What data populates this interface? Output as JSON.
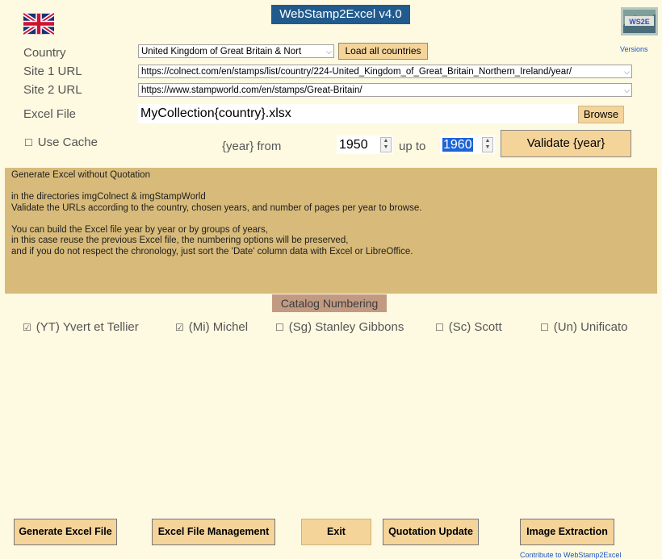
{
  "app": {
    "title": "WebStamp2Excel v4.0",
    "versions_link": "Versions"
  },
  "country": {
    "label": "Country",
    "value": "United Kingdom of Great Britain & Nort",
    "load_button": "Load all countries"
  },
  "site1": {
    "label": "Site 1 URL",
    "value": "https://colnect.com/en/stamps/list/country/224-United_Kingdom_of_Great_Britain_Northern_Ireland/year/"
  },
  "site2": {
    "label": "Site 2 URL",
    "value": "https://www.stampworld.com/en/stamps/Great-Britain/"
  },
  "excel": {
    "label": "Excel File",
    "value": "MyCollection{country}.xlsx",
    "browse_button": "Browse"
  },
  "cache": {
    "label": "Use Cache",
    "checked": false
  },
  "years": {
    "from_label": "{year} from",
    "from_value": "1950",
    "upto_label": "up to",
    "upto_value": "1960",
    "validate_button": "Validate {year}"
  },
  "info": {
    "line1": "Generate Excel without Quotation",
    "line2": "in the directories imgColnect & imgStampWorld",
    "line3": "Validate the URLs according to the country, chosen years, and number of pages per year to browse.",
    "line4": "You can build the Excel file year by year or by groups of years,",
    "line5": "in this case reuse the previous Excel file, the numbering options will be preserved,",
    "line6": "and if you do not respect the chronology, just sort the 'Date' column data with Excel or LibreOffice."
  },
  "catalog": {
    "title": "Catalog Numbering",
    "options": [
      {
        "label": "(YT) Yvert et Tellier",
        "checked": true
      },
      {
        "label": "(Mi) Michel",
        "checked": true
      },
      {
        "label": "(Sg) Stanley Gibbons",
        "checked": false
      },
      {
        "label": "(Sc) Scott",
        "checked": false
      },
      {
        "label": "(Un) Unificato",
        "checked": false
      }
    ]
  },
  "buttons": {
    "generate": "Generate Excel File",
    "management": "Excel File Management",
    "exit": "Exit",
    "quotation": "Quotation Update",
    "image": "Image Extraction"
  },
  "contribute_link": "Contribute to WebStamp2Excel",
  "colors": {
    "background": "#fef9e1",
    "title_bg": "#215a8c",
    "info_bg": "#d8bb7a",
    "button_bg": "#f5d49a",
    "catalog_bg": "#c29a82"
  }
}
